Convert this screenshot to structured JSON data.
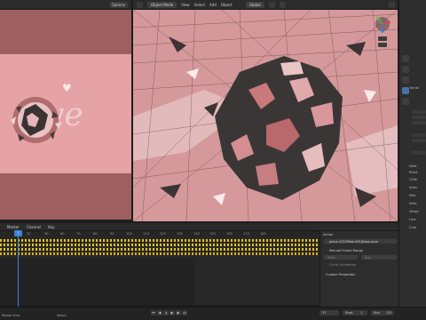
{
  "render_view": {
    "options_label": "Options"
  },
  "viewport_header": {
    "mode": "Object Mode",
    "menus": [
      "View",
      "Select",
      "Add",
      "Object"
    ],
    "transform": "Global"
  },
  "properties": {
    "labels": [
      "Transf",
      "Deltr",
      "Relat",
      "Colle",
      "Insta",
      "Moti",
      "Visib",
      "Viewp",
      "Line",
      "Cust"
    ]
  },
  "timeline": {
    "menus": [
      "Marker",
      "Channel",
      "Key"
    ],
    "ticks": [
      "20",
      "40",
      "60",
      "70",
      "80",
      "90",
      "100",
      "110",
      "120",
      "130",
      "140",
      "150",
      "160",
      "170",
      "180"
    ],
    "current_frame": "1",
    "key_color": "#e7c21a"
  },
  "action_panel": {
    "title": "Action",
    "action_name": "piece.1210Take.001|Base.dyar",
    "manual_frame_range": "Manual Frame Range",
    "start_label": "Start",
    "end_label": "End",
    "cyclic_label": "Cyclic Animation",
    "custom_props": "Custom Properties"
  },
  "footer": {
    "current_frame": "37",
    "start_label": "Start",
    "start_value": "1",
    "end_label": "End",
    "end_value": "131",
    "status_left": "Rotate View",
    "status_mid": "Select"
  },
  "colors": {
    "accent": "#3c82d6",
    "render_pink": "#e5a3a6",
    "viewport_pink": "#d49598"
  }
}
